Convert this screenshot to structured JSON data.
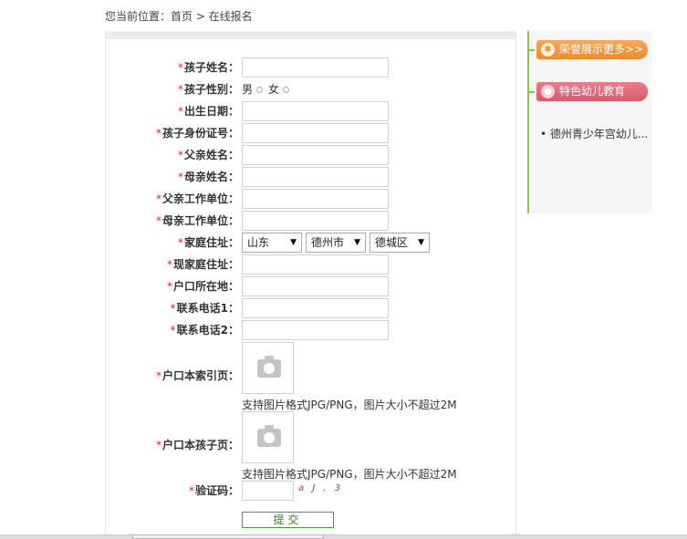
{
  "breadcrumb": "您当前位置：首页 > 在线报名",
  "required_mark": "*",
  "fields": [
    {
      "label": "孩子姓名："
    },
    {
      "label": "孩子性别："
    },
    {
      "label": "出生日期："
    },
    {
      "label": "孩子身份证号："
    },
    {
      "label": "父亲姓名："
    },
    {
      "label": "母亲姓名："
    },
    {
      "label": "父亲工作单位："
    },
    {
      "label": "母亲工作单位："
    },
    {
      "label": "家庭住址："
    },
    {
      "label": "现家庭住址："
    },
    {
      "label": "户口所在地："
    },
    {
      "label": "联系电话1："
    },
    {
      "label": "联系电话2："
    }
  ],
  "gender": {
    "male": "男",
    "female": "女"
  },
  "address": {
    "province": "山东",
    "city": "德州市",
    "district": "德城区"
  },
  "uploads": {
    "hukou_index_label": "户口本索引页：",
    "hukou_child_label": "户口本孩子页：",
    "hint": "支持图片格式JPG/PNG，图片大小不超过2M"
  },
  "captcha": {
    "label": "验证码：",
    "image_text": "a J , 3"
  },
  "submit_label": "提交",
  "sidebar": {
    "honor_tab": "荣誉展示更多>>",
    "feature_tab": "特色幼儿教育",
    "links": [
      "• 德州青少年宫幼儿..."
    ]
  }
}
